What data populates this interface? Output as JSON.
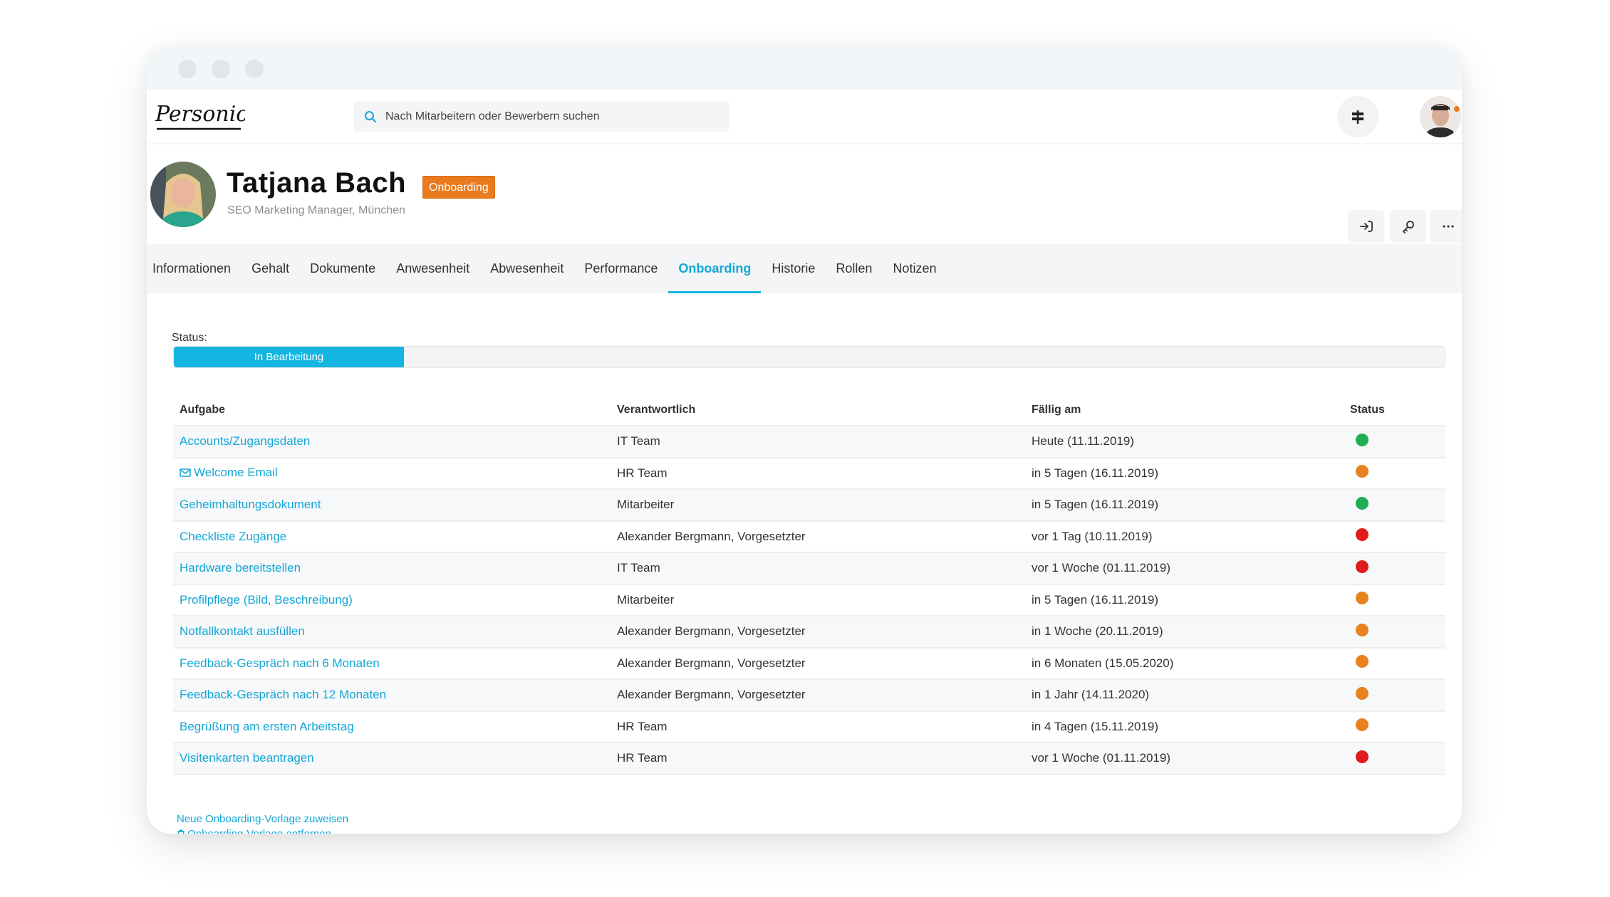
{
  "window": {
    "controls": [
      "close",
      "minimize",
      "maximize"
    ]
  },
  "topnav": {
    "logo_text": "Personio",
    "search": {
      "icon": "search-icon",
      "placeholder": "Nach Mitarbeitern oder Bewerbern suchen",
      "value": ""
    },
    "signpost_icon": "signpost-icon",
    "user_avatar": "user-avatar"
  },
  "profile": {
    "name": "Tatjana Bach",
    "badge": "Onboarding",
    "subtitle": "SEO Marketing Manager, München",
    "actions": [
      {
        "icon": "login-arrow-icon",
        "name": "login-as-button"
      },
      {
        "icon": "key-icon",
        "name": "access-rights-button"
      },
      {
        "icon": "more-icon",
        "name": "more-options-button"
      }
    ]
  },
  "tabs": [
    {
      "label": "Informationen",
      "active": false
    },
    {
      "label": "Gehalt",
      "active": false
    },
    {
      "label": "Dokumente",
      "active": false
    },
    {
      "label": "Anwesenheit",
      "active": false
    },
    {
      "label": "Abwesenheit",
      "active": false
    },
    {
      "label": "Performance",
      "active": false
    },
    {
      "label": "Onboarding",
      "active": true
    },
    {
      "label": "Historie",
      "active": false
    },
    {
      "label": "Rollen",
      "active": false
    },
    {
      "label": "Notizen",
      "active": false
    }
  ],
  "status": {
    "label": "Status:",
    "value": "In Bearbeitung",
    "progress_fraction": 0.124
  },
  "colors": {
    "accent": "#14b5e0",
    "link": "#14a6d6",
    "badge": "#ea7a1e",
    "status_green": "#1fae56",
    "status_orange": "#e8811f",
    "status_red": "#e01b1b"
  },
  "table": {
    "headers": [
      "Aufgabe",
      "Verantwortlich",
      "Fällig am",
      "Status"
    ],
    "rows": [
      {
        "task": "Accounts/Zugangsdaten",
        "icon": null,
        "owner": "IT Team",
        "due": "Heute (11.11.2019)",
        "status": "green"
      },
      {
        "task": "Welcome Email",
        "icon": "envelope-icon",
        "owner": "HR Team",
        "due": "in 5 Tagen (16.11.2019)",
        "status": "orange"
      },
      {
        "task": "Geheimhaltungsdokument",
        "icon": null,
        "owner": "Mitarbeiter",
        "due": "in 5 Tagen (16.11.2019)",
        "status": "green"
      },
      {
        "task": "Checkliste Zugänge",
        "icon": null,
        "owner": "Alexander Bergmann, Vorgesetzter",
        "due": "vor 1 Tag (10.11.2019)",
        "status": "red"
      },
      {
        "task": "Hardware bereitstellen",
        "icon": null,
        "owner": "IT Team",
        "due": "vor 1 Woche (01.11.2019)",
        "status": "red"
      },
      {
        "task": "Profilpflege (Bild, Beschreibung)",
        "icon": null,
        "owner": "Mitarbeiter",
        "due": "in 5 Tagen (16.11.2019)",
        "status": "orange"
      },
      {
        "task": "Notfallkontakt ausfüllen",
        "icon": null,
        "owner": "Alexander Bergmann, Vorgesetzter",
        "due": "in 1 Woche (20.11.2019)",
        "status": "orange"
      },
      {
        "task": "Feedback-Gespräch nach 6 Monaten",
        "icon": null,
        "owner": "Alexander Bergmann, Vorgesetzter",
        "due": "in 6 Monaten (15.05.2020)",
        "status": "orange"
      },
      {
        "task": "Feedback-Gespräch nach 12 Monaten",
        "icon": null,
        "owner": "Alexander Bergmann, Vorgesetzter",
        "due": "in 1 Jahr (14.11.2020)",
        "status": "orange"
      },
      {
        "task": "Begrüßung am ersten Arbeitstag",
        "icon": null,
        "owner": "HR Team",
        "due": "in 4 Tagen (15.11.2019)",
        "status": "orange"
      },
      {
        "task": "Visitenkarten beantragen",
        "icon": null,
        "owner": "HR Team",
        "due": "vor 1 Woche (01.11.2019)",
        "status": "red"
      }
    ]
  },
  "footer": {
    "assign_template": "Neue Onboarding-Vorlage zuweisen",
    "remove_template": "Onboarding-Vorlage entfernen"
  }
}
